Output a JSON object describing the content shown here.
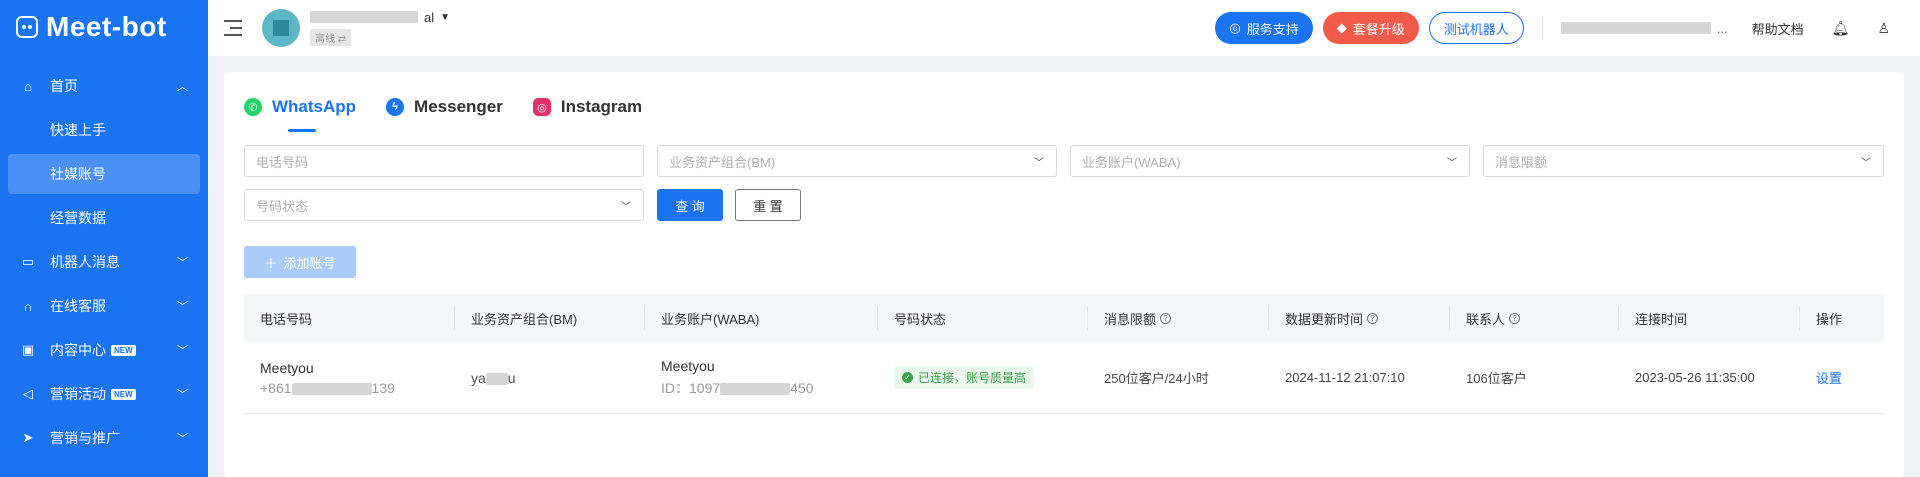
{
  "app": {
    "logo_text": "Meet-bot"
  },
  "sidebar": {
    "items": [
      {
        "label": "首页",
        "icon": "home-icon",
        "expanded": true,
        "children": [
          {
            "label": "快速上手"
          },
          {
            "label": "社媒账号",
            "active": true
          },
          {
            "label": "经营数据"
          }
        ]
      },
      {
        "label": "机器人消息",
        "icon": "chat-icon"
      },
      {
        "label": "在线客服",
        "icon": "headset-icon"
      },
      {
        "label": "内容中心",
        "icon": "lock-icon",
        "badge": "NEW"
      },
      {
        "label": "营销活动",
        "icon": "megaphone-icon",
        "badge": "NEW"
      },
      {
        "label": "营销与推广",
        "icon": "send-icon"
      }
    ]
  },
  "header": {
    "account_name_suffix": "al",
    "account_status": "离线",
    "support_label": "服务支持",
    "upgrade_label": "套餐升级",
    "test_bot_label": "测试机器人",
    "help_label": "帮助文档",
    "user_name_suffix": "..."
  },
  "tabs": [
    {
      "label": "WhatsApp",
      "icon": "whatsapp-icon",
      "active": true
    },
    {
      "label": "Messenger",
      "icon": "messenger-icon"
    },
    {
      "label": "Instagram",
      "icon": "instagram-icon"
    }
  ],
  "filters": {
    "phone_placeholder": "电话号码",
    "bm_placeholder": "业务资产组合(BM)",
    "waba_placeholder": "业务账户(WABA)",
    "limit_placeholder": "消息限额",
    "status_placeholder": "号码状态",
    "query_label": "查 询",
    "reset_label": "重 置",
    "add_label": "添加账号"
  },
  "table": {
    "columns": [
      "电话号码",
      "业务资产组合(BM)",
      "业务账户(WABA)",
      "号码状态",
      "消息限额",
      "数据更新时间",
      "联系人",
      "连接时间",
      "操作"
    ],
    "rows": [
      {
        "phone_name": "Meetyou",
        "phone_number_prefix": "+861",
        "phone_number_suffix": "139",
        "bm_prefix": "ya",
        "bm_suffix": "u",
        "waba_name": "Meetyou",
        "waba_id_prefix": "ID：1097",
        "waba_id_suffix": "450",
        "status": "已连接，账号质量高",
        "limit": "250位客户/24小时",
        "updated": "2024-11-12 21:07:10",
        "contacts": "106位客户",
        "connected": "2023-05-26 11:35:00",
        "action": "设置"
      }
    ]
  },
  "colors": {
    "primary": "#1a73f0",
    "danger": "#f25a4a",
    "success": "#3aa14a"
  }
}
